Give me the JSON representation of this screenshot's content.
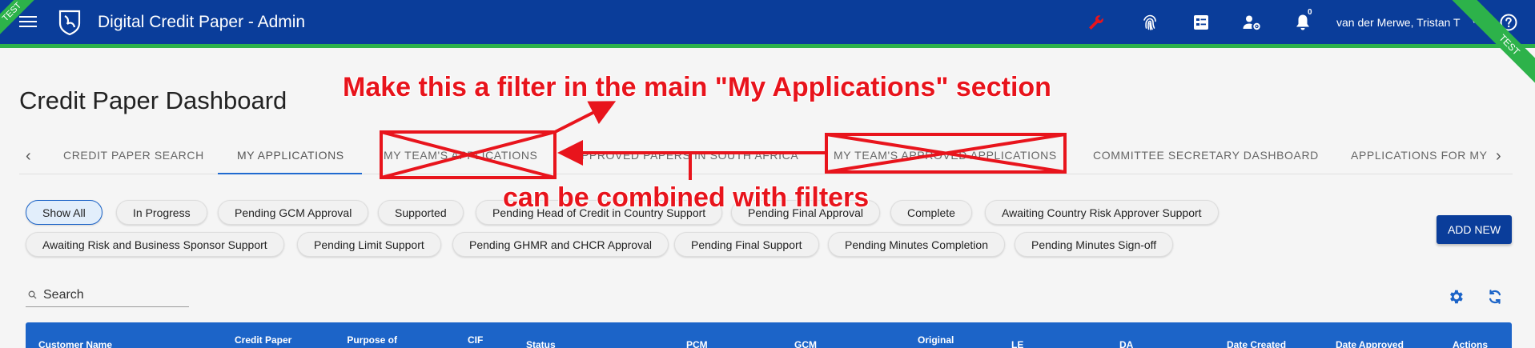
{
  "header": {
    "title": "Digital Credit Paper - Admin",
    "user_name": "van der Merwe, Tristan T",
    "notification_count": "0",
    "env_badge_left": "TEST",
    "env_badge_right": "TEST",
    "icons": [
      "menu-icon",
      "logo",
      "wrench-icon",
      "fingerprint-icon",
      "report-icon",
      "user-settings-icon",
      "bell-icon",
      "help-icon"
    ],
    "colors": {
      "bar": "#0a3d9a",
      "accent_stripe": "#2db24a",
      "wrench": "#e8141c"
    }
  },
  "page": {
    "title": "Credit Paper Dashboard"
  },
  "tabs": [
    {
      "label": "CREDIT PAPER SEARCH"
    },
    {
      "label": "MY APPLICATIONS",
      "active": true
    },
    {
      "label": "MY TEAM'S APPLICATIONS"
    },
    {
      "label": "APPROVED PAPERS IN SOUTH AFRICA"
    },
    {
      "label": "MY TEAM'S APPROVED APPLICATIONS"
    },
    {
      "label": "COMMITTEE SECRETARY DASHBOARD"
    },
    {
      "label": "APPLICATIONS FOR MY I"
    }
  ],
  "filters": [
    {
      "label": "Show All",
      "active": true
    },
    {
      "label": "In Progress"
    },
    {
      "label": "Pending GCM Approval"
    },
    {
      "label": "Supported"
    },
    {
      "label": "Pending Head of Credit in Country Support"
    },
    {
      "label": "Pending Final Approval"
    },
    {
      "label": "Complete"
    },
    {
      "label": "Awaiting Country Risk Approver Support"
    },
    {
      "label": "Awaiting Risk and Business Sponsor Support"
    },
    {
      "label": "Pending Limit Support"
    },
    {
      "label": "Pending GHMR and CHCR Approval"
    },
    {
      "label": "Pending Final Support"
    },
    {
      "label": "Pending Minutes Completion"
    },
    {
      "label": "Pending Minutes Sign-off"
    }
  ],
  "add_button": {
    "label": "ADD NEW"
  },
  "search": {
    "placeholder": "Search",
    "value": ""
  },
  "table": {
    "columns": [
      {
        "label": "Customer Name"
      },
      {
        "label": "Credit Paper\nT"
      },
      {
        "label": "Purpose of\nApplication"
      },
      {
        "label": "CIF\nNumber"
      },
      {
        "label": "Status"
      },
      {
        "label": "PCM"
      },
      {
        "label": "GCM"
      },
      {
        "label": "Original\nCredit"
      },
      {
        "label": "LE"
      },
      {
        "label": "DA"
      },
      {
        "label": "Date Created"
      },
      {
        "label": "Date Approved"
      },
      {
        "label": "Actions"
      }
    ]
  },
  "annotations": {
    "top_note": "Make this a filter in the main \"My Applications\" section",
    "middle_note": "can be combined with filters",
    "color": "#e8141c"
  }
}
